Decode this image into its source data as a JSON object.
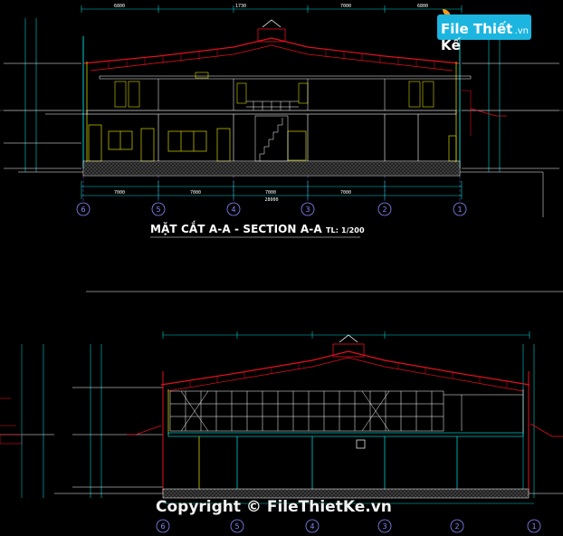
{
  "drawing": {
    "title": "MẶT CẮT A-A  - SECTION A-A",
    "scale": "TL: 1/200"
  },
  "grid_axes_top": [
    "6",
    "5",
    "4",
    "3",
    "2",
    "1"
  ],
  "grid_axes_bottom": [
    "6",
    "5",
    "4",
    "3",
    "2",
    "1"
  ],
  "top_dims": [
    "6800",
    "1730",
    "7000",
    "6800"
  ],
  "bottom_dims": [
    "7000",
    "7000",
    "7000",
    "7000"
  ],
  "total_dim": "28000",
  "watermark": {
    "logo_text": "File Thiết Kế",
    "logo_suffix": ".vn",
    "copyright": "Copyright © FileThietKe.vn"
  },
  "colors": {
    "background": "#000000",
    "wall": "#d4d400",
    "roof": "#e01020",
    "grid": "#8888ff",
    "dim": "#00d0d0",
    "text": "#ffffff"
  }
}
